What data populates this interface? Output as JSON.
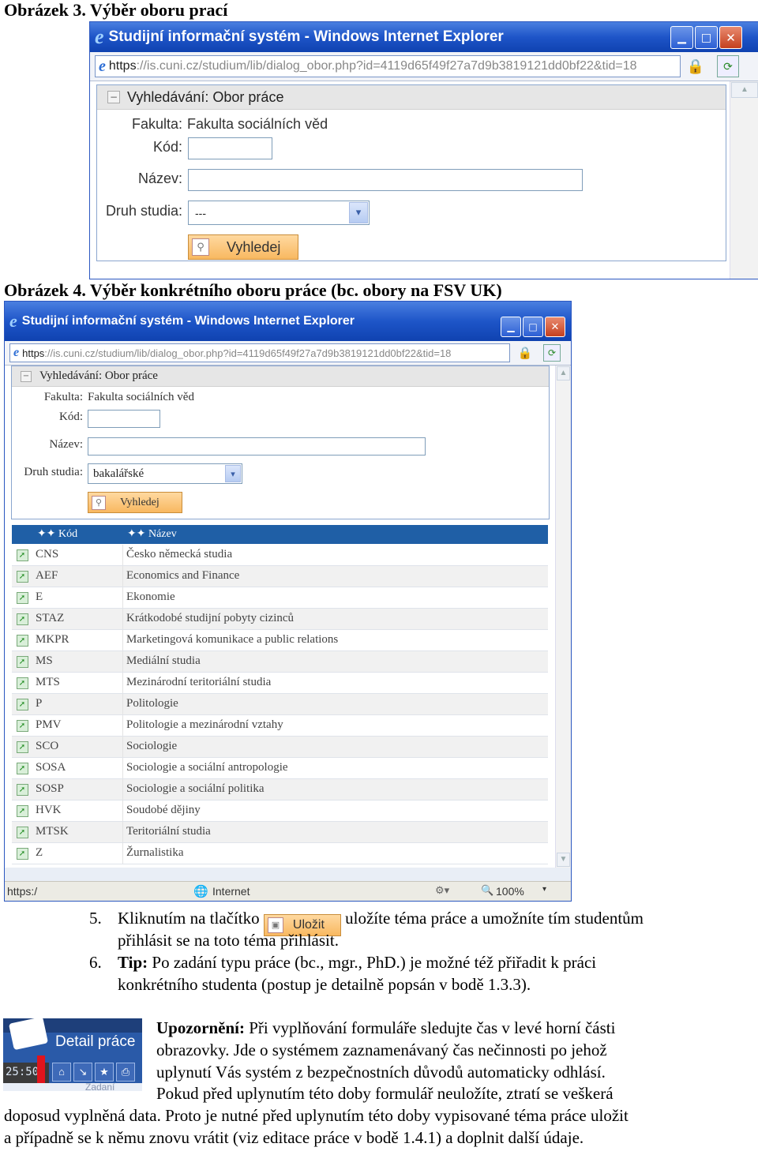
{
  "figure3": {
    "caption": "Obrázek 3. Výběr oboru prací",
    "window": {
      "logo_glyph": "e",
      "title": "Studijní informační systém - Windows Internet Explorer",
      "buttons": [
        "minimize",
        "maximize",
        "close"
      ],
      "url_https": "https",
      "url_rest": "://is.cuni.cz/studium/lib/dialog_obor.php?id=4119d65f49f27a7d9b3819121dd0bf22&tid=18"
    },
    "panel": {
      "title": "Vyhledávání: Obor práce",
      "fakulta_label": "Fakulta:",
      "fakulta_value": "Fakulta sociálních věd",
      "kod_label": "Kód:",
      "nazev_label": "Název:",
      "druh_label": "Druh studia:",
      "druh_value": "---",
      "search_button": "Vyhledej"
    }
  },
  "figure4": {
    "caption": "Obrázek 4. Výběr konkrétního oboru práce (bc. obory na FSV UK)",
    "window": {
      "logo_glyph": "e",
      "title": "Studijní informační systém - Windows Internet Explorer",
      "url_https": "https",
      "url_rest": "://is.cuni.cz/studium/lib/dialog_obor.php?id=4119d65f49f27a7d9b3819121dd0bf22&tid=18"
    },
    "panel": {
      "title": "Vyhledávání: Obor práce",
      "fakulta_label": "Fakulta:",
      "fakulta_value": "Fakulta sociálních věd",
      "kod_label": "Kód:",
      "nazev_label": "Název:",
      "druh_label": "Druh studia:",
      "druh_value": "bakalářské",
      "search_button": "Vyhledej"
    },
    "table": {
      "headers": {
        "kod": "✦✦ Kód",
        "nazev": "✦✦ Název"
      },
      "rows": [
        {
          "kod": "CNS",
          "nazev": "Česko německá studia"
        },
        {
          "kod": "AEF",
          "nazev": "Economics and Finance"
        },
        {
          "kod": "E",
          "nazev": "Ekonomie"
        },
        {
          "kod": "STAZ",
          "nazev": "Krátkodobé studijní pobyty cizinců"
        },
        {
          "kod": "MKPR",
          "nazev": "Marketingová komunikace a public relations"
        },
        {
          "kod": "MS",
          "nazev": "Mediální studia"
        },
        {
          "kod": "MTS",
          "nazev": "Mezinárodní teritoriální studia"
        },
        {
          "kod": "P",
          "nazev": "Politologie"
        },
        {
          "kod": "PMV",
          "nazev": "Politologie a mezinárodní vztahy"
        },
        {
          "kod": "SCO",
          "nazev": "Sociologie"
        },
        {
          "kod": "SOSA",
          "nazev": "Sociologie a sociální antropologie"
        },
        {
          "kod": "SOSP",
          "nazev": "Sociologie a sociální politika"
        },
        {
          "kod": "HVK",
          "nazev": "Soudobé dějiny"
        },
        {
          "kod": "MTSK",
          "nazev": "Teritoriální studia"
        },
        {
          "kod": "Z",
          "nazev": "Žurnalistika"
        }
      ]
    },
    "status": {
      "url": "https:/",
      "zone": "Internet",
      "zoom": "100%"
    }
  },
  "instructions": {
    "item5": {
      "number": "5.",
      "before": "Kliknutím na tlačítko",
      "button": "Uložit",
      "after": "uložíte téma práce a umožníte tím studentům",
      "line2": "přihlásit se na toto téma přihlásit."
    },
    "item6": {
      "number": "6.",
      "tip_label": "Tip:",
      "line1": " Po zadání typu práce (bc., mgr., PhD.) je možné též přiřadit k práci",
      "line2": "konkrétního studenta (postup je detailně popsán v bodě 1.3.3)."
    }
  },
  "warning": {
    "thumbnail": {
      "title": "Detail práce",
      "timer": "25:50",
      "bottom_text": "Zadaní"
    },
    "label": "Upozornění:",
    "line1": " Při vyplňování formuláře sledujte čas v levé horní části",
    "line2": "obrazovky. Jde o systémem zaznamenávaný čas nečinnosti po jehož",
    "line3": "uplynutí Vás systém z bezpečnostních důvodů automaticky odhlásí.",
    "line4": "Pokud před uplynutím této doby formulář neuložíte, ztratí se veškerá",
    "line5": "doposud vyplněná data. Proto je nutné před uplynutím této doby vypisované téma práce uložit",
    "line6": "a případně se k němu znovu vrátit (viz editace práce v bodě 1.4.1) a doplnit další údaje."
  }
}
